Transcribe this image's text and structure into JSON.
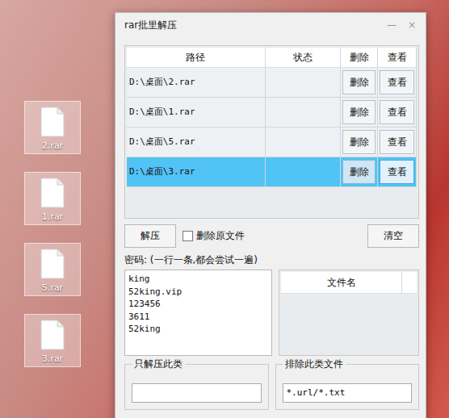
{
  "window": {
    "title": "rar批里解压",
    "controls": [
      "—",
      "×"
    ]
  },
  "desktop_icons": [
    {
      "label": "2.rar"
    },
    {
      "label": "1.rar"
    },
    {
      "label": "5.rar"
    },
    {
      "label": "3.rar"
    }
  ],
  "table": {
    "columns": [
      "路径",
      "状态",
      "删除",
      "查看"
    ],
    "rows": [
      {
        "path": "D:\\桌面\\2.rar",
        "status": "",
        "delete": "删除",
        "view": "查看",
        "selected": false
      },
      {
        "path": "D:\\桌面\\1.rar",
        "status": "",
        "delete": "删除",
        "view": "查看",
        "selected": false
      },
      {
        "path": "D:\\桌面\\5.rar",
        "status": "",
        "delete": "删除",
        "view": "查看",
        "selected": false
      },
      {
        "path": "D:\\桌面\\3.rar",
        "status": "",
        "delete": "删除",
        "view": "查看",
        "selected": true
      }
    ]
  },
  "extract_button": "解压",
  "delete_source": {
    "label": "删除原文件",
    "checked": false
  },
  "clear_button": "清空",
  "password_label": "密码: (一行一条,都会尝试一遍)",
  "passwords": [
    "king",
    "52king.vip",
    "123456",
    "3611",
    "52king"
  ],
  "file_list": {
    "columns": [
      "文件名"
    ]
  },
  "include_filter": {
    "label": "只解压此类",
    "value": ""
  },
  "exclude_filter": {
    "label": "排除此类文件",
    "value": "*.url/*.txt"
  }
}
